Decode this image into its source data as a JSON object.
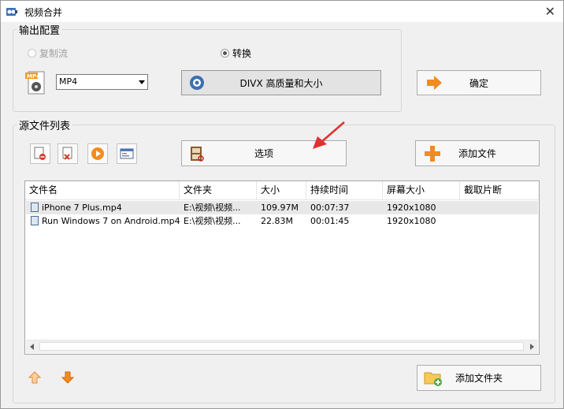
{
  "window": {
    "title": "视频合并"
  },
  "output_group": {
    "legend": "输出配置",
    "radio_copy": "复制流",
    "radio_convert": "转换",
    "format_select": "MP4",
    "quality_button": "DIVX 高质量和大小",
    "confirm_button": "确定"
  },
  "source_group": {
    "legend": "源文件列表",
    "options_button": "选项",
    "add_file_button": "添加文件",
    "add_folder_button": "添加文件夹",
    "columns": [
      "文件名",
      "文件夹",
      "大小",
      "持续时间",
      "屏幕大小",
      "截取片断"
    ],
    "rows": [
      {
        "name": "iPhone 7 Plus.mp4",
        "folder": "E:\\视频\\视频...",
        "size": "109.97M",
        "duration": "00:07:37",
        "resolution": "1920x1080",
        "clip": ""
      },
      {
        "name": "Run Windows 7 on Android.mp4",
        "folder": "E:\\视频\\视频...",
        "size": "22.83M",
        "duration": "00:01:45",
        "resolution": "1920x1080",
        "clip": ""
      }
    ]
  },
  "colors": {
    "accent_orange": "#f28c1e",
    "arrow_red": "#e03030"
  }
}
